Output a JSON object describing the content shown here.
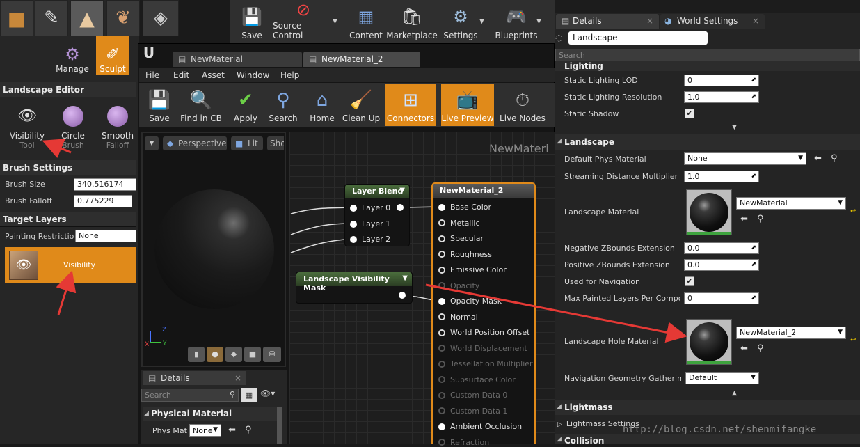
{
  "modes": {
    "manage_label": "Manage",
    "sculpt_label": "Sculpt"
  },
  "main_toolbar": {
    "save": "Save",
    "source_control": "Source Control",
    "content": "Content",
    "marketplace": "Marketplace",
    "settings": "Settings",
    "blueprints": "Blueprints"
  },
  "landscape_editor": {
    "title": "Landscape Editor",
    "tools": [
      {
        "label": "Visibility",
        "sub": "Tool"
      },
      {
        "label": "Circle",
        "sub": "Brush"
      },
      {
        "label": "Smooth",
        "sub": "Falloff"
      }
    ],
    "brush_settings": "Brush Settings",
    "brush_size_label": "Brush Size",
    "brush_size_value": "340.516174",
    "brush_falloff_label": "Brush Falloff",
    "brush_falloff_value": "0.775229",
    "target_layers": "Target Layers",
    "painting_restriction_label": "Painting Restrictio",
    "painting_restriction_value": "None",
    "layer_label": "Visibility"
  },
  "material_editor": {
    "tabs": [
      "NewMaterial",
      "NewMaterial_2"
    ],
    "menu": [
      "File",
      "Edit",
      "Asset",
      "Window",
      "Help"
    ],
    "toolbar": [
      "Save",
      "Find in CB",
      "Apply",
      "Search",
      "Home",
      "Clean Up",
      "Connectors",
      "Live Preview",
      "Live Nodes"
    ],
    "viewport": {
      "perspective": "Perspective",
      "lit": "Lit",
      "show": "Sho"
    },
    "graph_title": "NewMateri",
    "layer_blend": {
      "title": "Layer Blend",
      "pins": [
        "Layer 0",
        "Layer 1",
        "Layer 2"
      ]
    },
    "vis_mask": {
      "title": "Landscape Visibility Mask"
    },
    "result_node": {
      "title": "NewMaterial_2",
      "pins": [
        {
          "label": "Base Color",
          "enabled": true
        },
        {
          "label": "Metallic",
          "enabled": true
        },
        {
          "label": "Specular",
          "enabled": true
        },
        {
          "label": "Roughness",
          "enabled": true
        },
        {
          "label": "Emissive Color",
          "enabled": true
        },
        {
          "label": "Opacity",
          "enabled": false
        },
        {
          "label": "Opacity Mask",
          "enabled": true
        },
        {
          "label": "Normal",
          "enabled": true
        },
        {
          "label": "World Position Offset",
          "enabled": true
        },
        {
          "label": "World Displacement",
          "enabled": false
        },
        {
          "label": "Tessellation Multiplier",
          "enabled": false
        },
        {
          "label": "Subsurface Color",
          "enabled": false
        },
        {
          "label": "Custom Data 0",
          "enabled": false
        },
        {
          "label": "Custom Data 1",
          "enabled": false
        },
        {
          "label": "Ambient Occlusion",
          "enabled": true
        },
        {
          "label": "Refraction",
          "enabled": false
        }
      ]
    },
    "details": {
      "tab": "Details",
      "search_placeholder": "Search",
      "physical_material": "Physical Material",
      "phys_mat_label": "Phys Mat",
      "phys_mat_value": "None"
    }
  },
  "details_panel": {
    "tabs": [
      "Details",
      "World Settings"
    ],
    "object_name": "Landscape",
    "search_placeholder": "Search",
    "lighting": "Lighting",
    "static_lighting_lod_label": "Static Lighting LOD",
    "static_lighting_lod_value": "0",
    "static_lighting_res_label": "Static Lighting Resolution",
    "static_lighting_res_value": "1.0",
    "static_shadow_label": "Static Shadow",
    "static_shadow_checked": true,
    "landscape_section": "Landscape",
    "default_phys_label": "Default Phys Material",
    "default_phys_value": "None",
    "streaming_label": "Streaming Distance Multiplier",
    "streaming_value": "1.0",
    "landscape_material_label": "Landscape Material",
    "landscape_material_value": "NewMaterial",
    "neg_z_label": "Negative ZBounds Extension",
    "neg_z_value": "0.0",
    "pos_z_label": "Positive ZBounds Extension",
    "pos_z_value": "0.0",
    "used_nav_label": "Used for Navigation",
    "used_nav_checked": true,
    "max_painted_label": "Max Painted Layers Per Compone",
    "max_painted_value": "0",
    "hole_material_label": "Landscape Hole Material",
    "hole_material_value": "NewMaterial_2",
    "nav_geom_label": "Navigation Geometry Gathering M",
    "nav_geom_value": "Default",
    "lightmass": "Lightmass",
    "lightmass_settings": "Lightmass Settings",
    "collision": "Collision"
  },
  "watermark": "http://blog.csdn.net/shenmifangke",
  "colors": {
    "accent": "#e08a1a",
    "arrow": "#e53935"
  }
}
